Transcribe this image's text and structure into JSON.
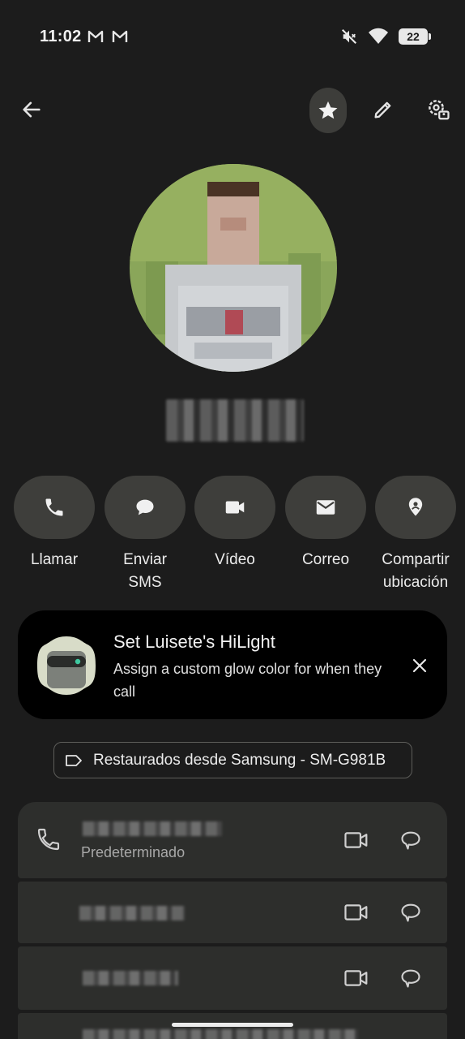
{
  "status_bar": {
    "time": "11:02",
    "battery_level": "22",
    "icons": [
      "gmail-icon",
      "gmail-icon",
      "vibrate-mute-icon",
      "wifi-icon",
      "battery-icon"
    ]
  },
  "toolbar": {
    "back_icon": "arrow-back-icon",
    "favorite_icon": "star-icon",
    "edit_icon": "pencil-icon",
    "settings_icon": "manage-account-icon"
  },
  "actions": [
    {
      "label": "Llamar",
      "icon": "phone-icon"
    },
    {
      "label": "Enviar SMS",
      "icon": "chat-bubble-icon"
    },
    {
      "label": "Vídeo",
      "icon": "videocam-icon"
    },
    {
      "label": "Correo",
      "icon": "mail-icon"
    },
    {
      "label": "Compartir ubicación",
      "icon": "location-icon"
    }
  ],
  "hilight_card": {
    "title": "Set Luisete's HiLight",
    "body": "Assign a custom glow color for when they call"
  },
  "label_chip": {
    "text": "Restaurados desde Samsung - SM-G981B",
    "icon": "label-icon"
  },
  "phones": [
    {
      "type": "Predeterminado"
    }
  ],
  "colors": {
    "background": "#1c1c1c",
    "surface": "#2d2e2c",
    "action_button": "#3e3e3b",
    "card": "#000000"
  }
}
